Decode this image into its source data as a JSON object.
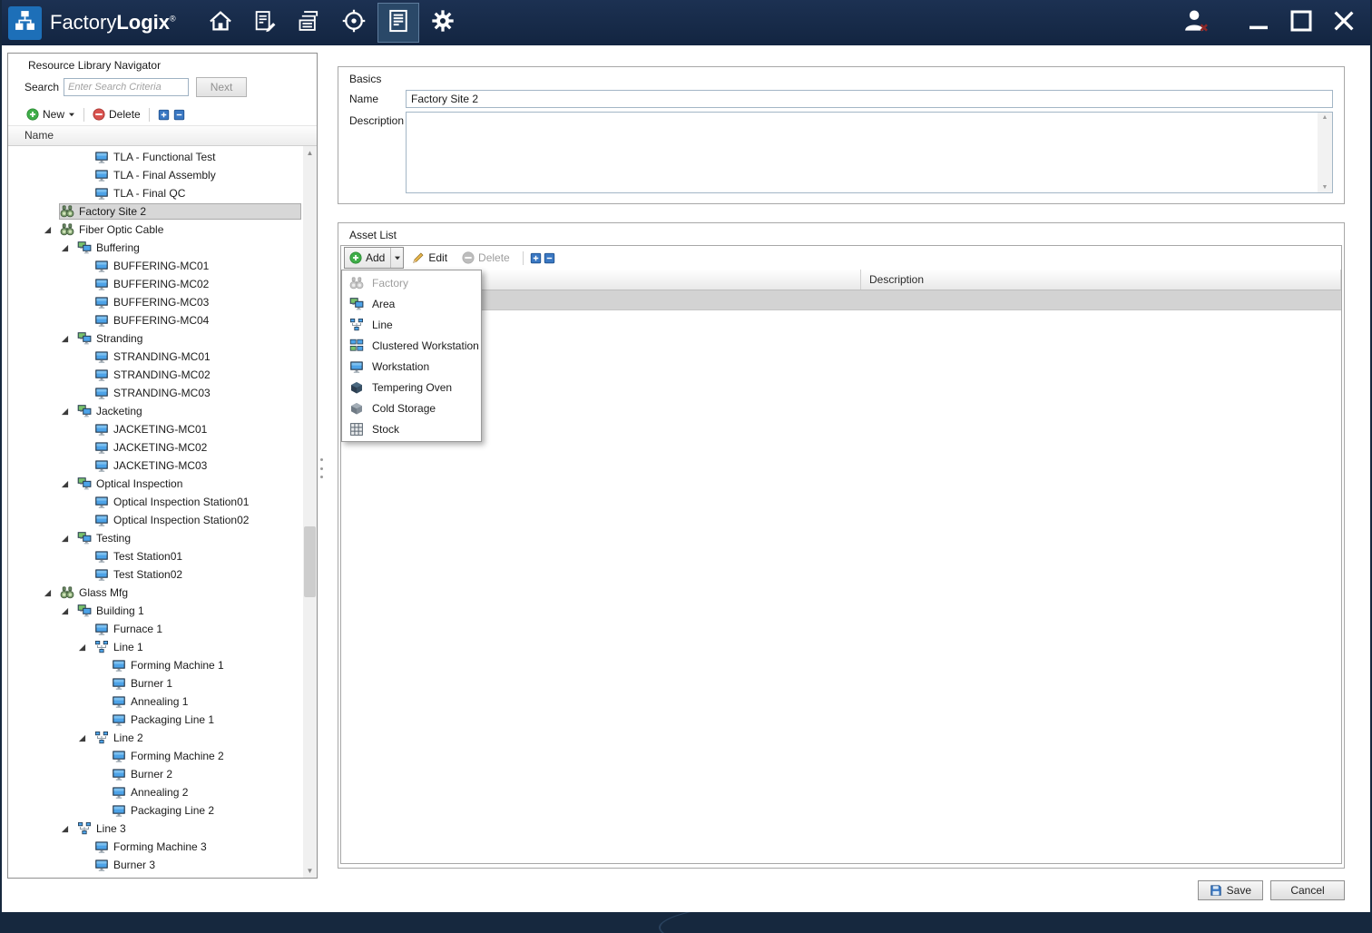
{
  "titlebar": {
    "brand": {
      "part1": "Factory",
      "part2": "Logix",
      "registered": "®"
    },
    "nav": [
      {
        "icon": "home"
      },
      {
        "icon": "forms"
      },
      {
        "icon": "documents"
      },
      {
        "icon": "target"
      },
      {
        "icon": "report",
        "active": true
      },
      {
        "icon": "gear"
      }
    ],
    "window_controls": [
      {
        "icon": "user-signout"
      },
      {
        "icon": "minimize"
      },
      {
        "icon": "maximize"
      },
      {
        "icon": "close"
      }
    ]
  },
  "sidebar": {
    "title": "Resource Library Navigator",
    "search": {
      "label": "Search",
      "placeholder": "Enter Search Criteria",
      "next_label": "Next"
    },
    "toolbar": {
      "new_label": "New",
      "delete_label": "Delete"
    },
    "tree_header": "Name",
    "tree": [
      {
        "label": "TLA - Functional Test",
        "level": 3,
        "icon": "workstation"
      },
      {
        "label": "TLA - Final Assembly",
        "level": 3,
        "icon": "workstation"
      },
      {
        "label": "TLA - Final QC",
        "level": 3,
        "icon": "workstation"
      },
      {
        "label": "Factory Site 2",
        "level": 1,
        "icon": "factory",
        "selected": true
      },
      {
        "label": "Fiber Optic Cable",
        "level": 1,
        "icon": "factory",
        "expanded": true
      },
      {
        "label": "Buffering",
        "level": 2,
        "icon": "area",
        "expanded": true
      },
      {
        "label": "BUFFERING-MC01",
        "level": 3,
        "icon": "workstation"
      },
      {
        "label": "BUFFERING-MC02",
        "level": 3,
        "icon": "workstation"
      },
      {
        "label": "BUFFERING-MC03",
        "level": 3,
        "icon": "workstation"
      },
      {
        "label": "BUFFERING-MC04",
        "level": 3,
        "icon": "workstation"
      },
      {
        "label": "Stranding",
        "level": 2,
        "icon": "area",
        "expanded": true
      },
      {
        "label": "STRANDING-MC01",
        "level": 3,
        "icon": "workstation"
      },
      {
        "label": "STRANDING-MC02",
        "level": 3,
        "icon": "workstation"
      },
      {
        "label": "STRANDING-MC03",
        "level": 3,
        "icon": "workstation"
      },
      {
        "label": "Jacketing",
        "level": 2,
        "icon": "area",
        "expanded": true
      },
      {
        "label": "JACKETING-MC01",
        "level": 3,
        "icon": "workstation"
      },
      {
        "label": "JACKETING-MC02",
        "level": 3,
        "icon": "workstation"
      },
      {
        "label": "JACKETING-MC03",
        "level": 3,
        "icon": "workstation"
      },
      {
        "label": "Optical Inspection",
        "level": 2,
        "icon": "area",
        "expanded": true
      },
      {
        "label": "Optical Inspection Station01",
        "level": 3,
        "icon": "workstation"
      },
      {
        "label": "Optical Inspection Station02",
        "level": 3,
        "icon": "workstation"
      },
      {
        "label": "Testing",
        "level": 2,
        "icon": "area",
        "expanded": true
      },
      {
        "label": "Test Station01",
        "level": 3,
        "icon": "workstation"
      },
      {
        "label": "Test Station02",
        "level": 3,
        "icon": "workstation"
      },
      {
        "label": "Glass Mfg",
        "level": 1,
        "icon": "factory",
        "expanded": true
      },
      {
        "label": "Building 1",
        "level": 2,
        "icon": "area",
        "expanded": true
      },
      {
        "label": "Furnace 1",
        "level": 3,
        "icon": "workstation"
      },
      {
        "label": "Line 1",
        "level": 3,
        "icon": "line",
        "expanded": true
      },
      {
        "label": "Forming Machine 1",
        "level": 4,
        "icon": "workstation"
      },
      {
        "label": "Burner 1",
        "level": 4,
        "icon": "workstation"
      },
      {
        "label": "Annealing 1",
        "level": 4,
        "icon": "workstation"
      },
      {
        "label": "Packaging Line 1",
        "level": 4,
        "icon": "workstation"
      },
      {
        "label": "Line 2",
        "level": 3,
        "icon": "line",
        "expanded": true
      },
      {
        "label": "Forming Machine 2",
        "level": 4,
        "icon": "workstation"
      },
      {
        "label": "Burner 2",
        "level": 4,
        "icon": "workstation"
      },
      {
        "label": "Annealing 2",
        "level": 4,
        "icon": "workstation"
      },
      {
        "label": "Packaging Line 2",
        "level": 4,
        "icon": "workstation"
      },
      {
        "label": "Line 3",
        "level": 2,
        "icon": "line",
        "expanded": true
      },
      {
        "label": "Forming Machine 3",
        "level": 3,
        "icon": "workstation"
      },
      {
        "label": "Burner 3",
        "level": 3,
        "icon": "workstation"
      }
    ]
  },
  "main": {
    "basics": {
      "title": "Basics",
      "name_label": "Name",
      "name_value": "Factory Site 2",
      "description_label": "Description",
      "description_value": ""
    },
    "asset_list": {
      "title": "Asset List",
      "toolbar": {
        "add_label": "Add",
        "edit_label": "Edit",
        "delete_label": "Delete"
      },
      "columns": [
        {
          "label": ""
        },
        {
          "label": "Description"
        }
      ],
      "add_menu": [
        {
          "label": "Factory",
          "icon": "factory",
          "disabled": true
        },
        {
          "label": "Area",
          "icon": "area"
        },
        {
          "label": "Line",
          "icon": "line"
        },
        {
          "label": "Clustered Workstation",
          "icon": "clustered-workstation"
        },
        {
          "label": "Workstation",
          "icon": "workstation"
        },
        {
          "label": "Tempering Oven",
          "icon": "tempering-oven"
        },
        {
          "label": "Cold Storage",
          "icon": "cold-storage"
        },
        {
          "label": "Stock",
          "icon": "stock"
        }
      ]
    },
    "footer": {
      "save_label": "Save",
      "cancel_label": "Cancel"
    }
  },
  "colors": {
    "titlebar": "#16283e",
    "logo_blue": "#1d6fb8",
    "selection_gray": "#d7d7d7",
    "new_green": "#3fae49",
    "delete_red": "#d9534f",
    "tool_blue": "#3a78c3"
  }
}
